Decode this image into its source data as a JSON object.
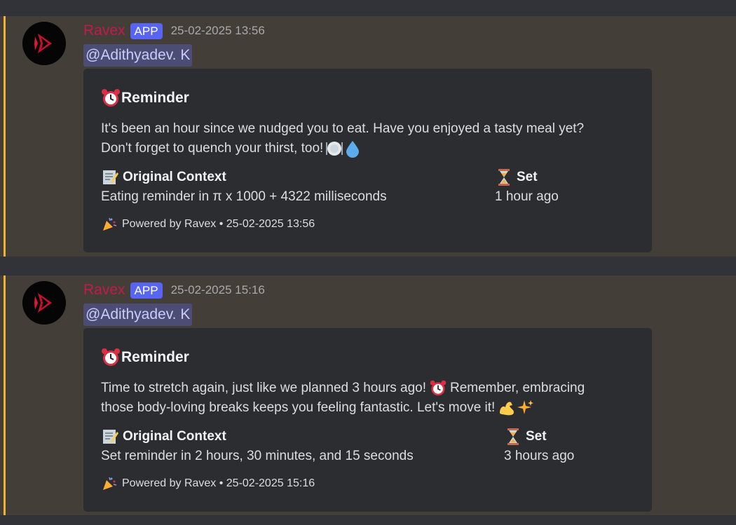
{
  "colors": {
    "background": "#323339",
    "message_highlight": "#433f38",
    "mention_stripe": "#f0b232",
    "author": "#c41a4a",
    "app_badge": "#5865f2",
    "mention_bg": "#4b4d74",
    "embed_bg": "#2b2d31"
  },
  "messages": [
    {
      "author": "Ravex",
      "badge": "APP",
      "timestamp": "25-02-2025 13:56",
      "mention": "@Adithyadev. K",
      "embed": {
        "title_icon": "alarm-clock-icon",
        "title": "Reminder",
        "description_line1": "It's been an hour since we nudged you to eat. Have you enjoyed a tasty meal yet?",
        "description_line2": "Don't forget to quench your thirst, too!",
        "description_emojis": [
          "plate-icon",
          "droplet-icon"
        ],
        "field1_icon": "memo-icon",
        "field1_name": "Original Context",
        "field1_value": "Eating reminder in π x 1000 + 4322 milliseconds",
        "field2_icon": "hourglass-icon",
        "field2_name": "Set",
        "field2_value": "1 hour ago",
        "footer_icon": "party-popper-icon",
        "footer": "Powered by Ravex • 25-02-2025 13:56"
      }
    },
    {
      "author": "Ravex",
      "badge": "APP",
      "timestamp": "25-02-2025 15:16",
      "mention": "@Adithyadev. K",
      "embed": {
        "title_icon": "alarm-clock-icon",
        "title": "Reminder",
        "description_line1a": "Time to stretch again, just like we planned 3 hours ago!",
        "description_line1b": "Remember, embracing",
        "description_line2": "those body-loving breaks keeps you feeling fantastic. Let's move it!",
        "description_emojis": [
          "alarm-clock-icon",
          "flexed-biceps-icon",
          "sparkles-icon"
        ],
        "field1_icon": "memo-icon",
        "field1_name": "Original Context",
        "field1_value": "Set reminder in 2 hours, 30 minutes, and 15 seconds",
        "field2_icon": "hourglass-icon",
        "field2_name": "Set",
        "field2_value": "3 hours ago",
        "footer_icon": "party-popper-icon",
        "footer": "Powered by Ravex • 25-02-2025 15:16"
      }
    }
  ]
}
